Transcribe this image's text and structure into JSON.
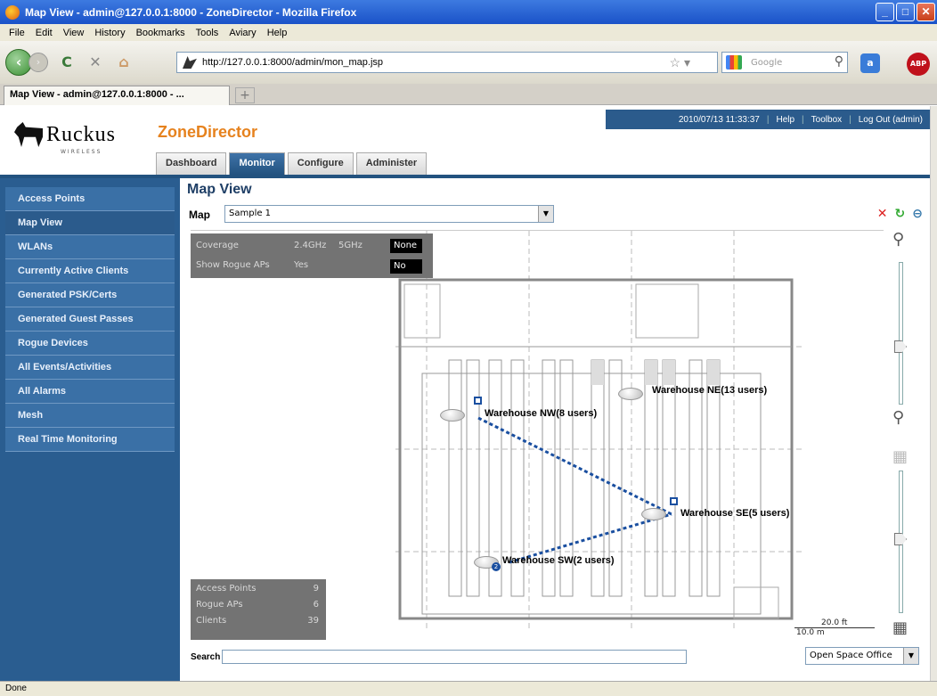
{
  "window": {
    "title": "Map View - admin@127.0.0.1:8000 - ZoneDirector - Mozilla Firefox"
  },
  "menu": [
    "File",
    "Edit",
    "View",
    "History",
    "Bookmarks",
    "Tools",
    "Aviary",
    "Help"
  ],
  "nav": {
    "url": "http://127.0.0.1:8000/admin/mon_map.jsp",
    "search_placeholder": "Google"
  },
  "tab": {
    "label": "Map View - admin@127.0.0.1:8000 - ..."
  },
  "header": {
    "logo_text": "Ruckus",
    "logo_sub": "WIRELESS",
    "product": "ZoneDirector",
    "datetime": "2010/07/13 11:33:37",
    "help": "Help",
    "toolbox": "Toolbox",
    "logout": "Log Out (admin)",
    "tabs": [
      "Dashboard",
      "Monitor",
      "Configure",
      "Administer"
    ]
  },
  "sidebar": {
    "items": [
      "Access Points",
      "Map View",
      "WLANs",
      "Currently Active Clients",
      "Generated PSK/Certs",
      "Generated Guest Passes",
      "Rogue Devices",
      "All Events/Activities",
      "All Alarms",
      "Mesh",
      "Real Time Monitoring"
    ],
    "active_index": 1
  },
  "main": {
    "title": "Map View",
    "map_label": "Map",
    "map_selected": "Sample 1",
    "coverage": {
      "label": "Coverage",
      "opt_24": "2.4GHz",
      "opt_5": "5GHz",
      "opt_none": "None",
      "rogue_label": "Show Rogue APs",
      "rogue_yes": "Yes",
      "rogue_no": "No"
    },
    "stats": [
      {
        "label": "Access Points",
        "value": "9"
      },
      {
        "label": "Rogue APs",
        "value": "6"
      },
      {
        "label": "Clients",
        "value": "39"
      }
    ],
    "aps": [
      {
        "name": "Warehouse NE(13 users)"
      },
      {
        "name": "Warehouse NW(8 users)"
      },
      {
        "name": "Warehouse SE(5 users)"
      },
      {
        "name": "Warehouse SW(2 users)"
      }
    ],
    "scale_ft": "20.0 ft",
    "scale_m": "10.0 m",
    "search_label": "Search",
    "view_selected": "Open Space Office"
  },
  "status": "Done",
  "colors": {
    "sidebar": "#2a5d90",
    "accent": "#e6821e",
    "mesh_link": "#1a4fa0"
  }
}
